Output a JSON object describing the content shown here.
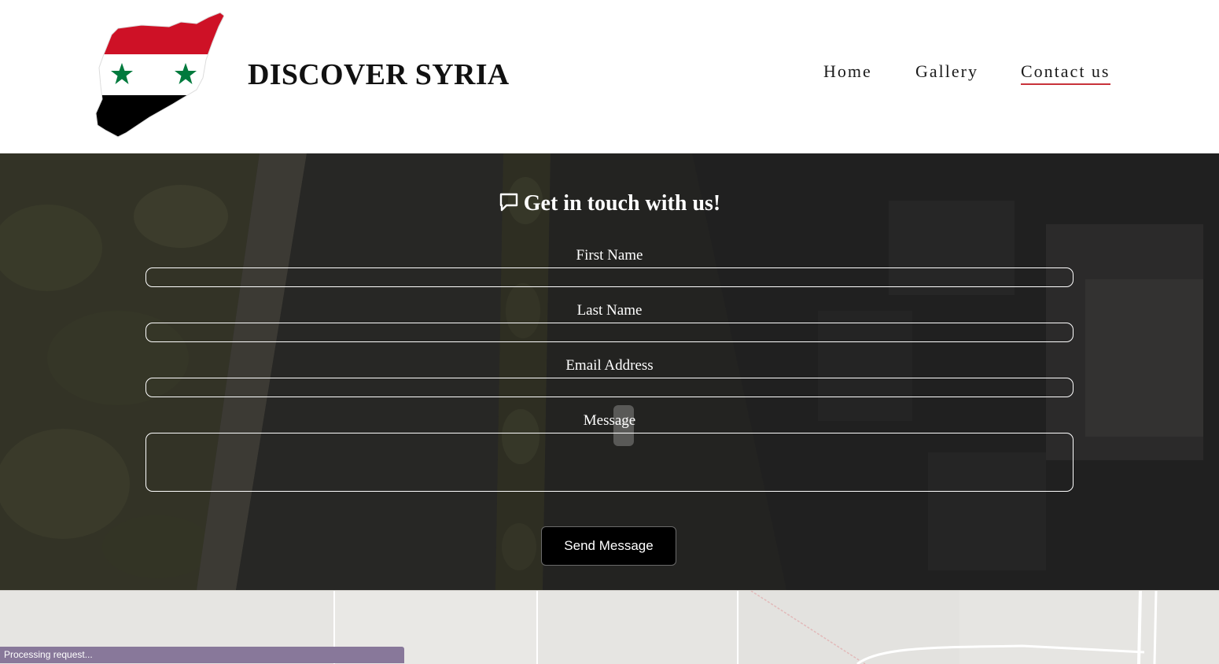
{
  "header": {
    "brand": "DISCOVER SYRIA",
    "nav": [
      {
        "label": "Home",
        "active": false
      },
      {
        "label": "Gallery",
        "active": false
      },
      {
        "label": "Contact us",
        "active": true
      }
    ],
    "accent_color": "#c8323a"
  },
  "logo": {
    "icon": "syria-flag-map",
    "colors": {
      "red": "#ce1126",
      "white": "#ffffff",
      "black": "#000000",
      "green": "#007a3d"
    }
  },
  "contact_form": {
    "title": "Get in touch with us!",
    "title_icon": "chat-bubble-icon",
    "fields": {
      "first_name": {
        "label": "First Name",
        "value": ""
      },
      "last_name": {
        "label": "Last Name",
        "value": ""
      },
      "email": {
        "label": "Email Address",
        "value": ""
      },
      "message": {
        "label": "Message",
        "value": ""
      }
    },
    "submit_label": "Send Message"
  },
  "status": {
    "text": "Processing request..."
  }
}
